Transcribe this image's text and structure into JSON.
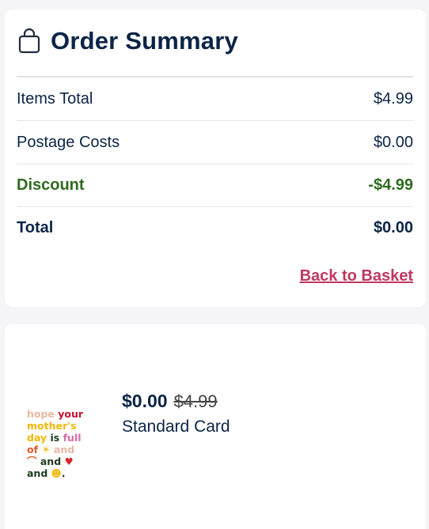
{
  "summary": {
    "title": "Order Summary",
    "icon": "shopping-bag-icon",
    "rows": [
      {
        "label": "Items Total",
        "value": "$4.99"
      },
      {
        "label": "Postage Costs",
        "value": "$0.00"
      },
      {
        "label": "Discount",
        "value": "-$4.99"
      },
      {
        "label": "Total",
        "value": "$0.00"
      }
    ],
    "back_link": "Back to Basket"
  },
  "product": {
    "price": "$0.00",
    "original_price": "$4.99",
    "name": "Standard Card",
    "card_text": {
      "w1": "hope",
      "w2": "your",
      "w3": "mother's",
      "w4": "day",
      "w5": "is",
      "w6": "full",
      "w7": "of",
      "w8": "and",
      "w9": "and",
      "w10": "and"
    }
  },
  "colors": {
    "navy": "#0b2447",
    "discount_green": "#2e6b1f",
    "link_red": "#c2375e"
  }
}
